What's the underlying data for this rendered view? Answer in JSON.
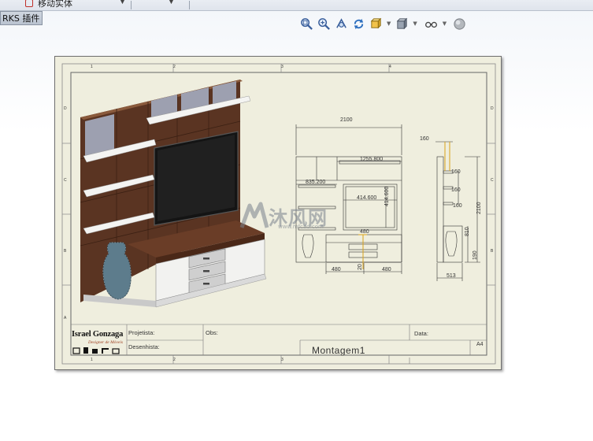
{
  "toolbar": {
    "command_label": "移动实体",
    "plugin_tab": "RKS 插件"
  },
  "view_toolbar": {
    "icons": [
      "zoom-to-fit-icon",
      "zoom-area-icon",
      "previous-view-icon",
      "rebuild-icon",
      "view-orientation-icon",
      "display-style-icon",
      "hide-show-icon",
      "appearance-icon"
    ]
  },
  "sheet": {
    "zone_numbers_top": [
      "1",
      "2",
      "3",
      "4"
    ],
    "zone_letters_left": [
      "A",
      "B",
      "C",
      "D"
    ],
    "dimensions": {
      "front_width": "2100",
      "front_inner_width": "1255.800",
      "front_left_width": "835.200",
      "tv_width": "414.600",
      "tv_height": "414.600",
      "bottom_mid": "480",
      "bottom_left": "480",
      "bottom_right": "480",
      "bottom_depth": "20",
      "side_top": "160",
      "side_shelf_1": "160",
      "side_shelf_2": "160",
      "side_shelf_3": "160",
      "side_height": "2100",
      "side_lower": "810",
      "side_base": "190",
      "side_depth": "513"
    },
    "title_block": {
      "company": "Israel Gonzaga",
      "company_sub": "Designer de Móveis",
      "projetista_label": "Projetista:",
      "desenhista_label": "Desenhista:",
      "obs_label": "Obs:",
      "data_label": "Data:",
      "drawing_name": "Montagem1",
      "sheet_size": "A4"
    },
    "watermark": {
      "text": "沐风网",
      "url": "www.mfcad.com"
    }
  },
  "colors": {
    "sheet_bg": "#efeede",
    "wood": "#5a3422",
    "wood_light": "#7a4a30",
    "dimension_line": "#333333",
    "highlight_dimension": "#d9a31a"
  }
}
